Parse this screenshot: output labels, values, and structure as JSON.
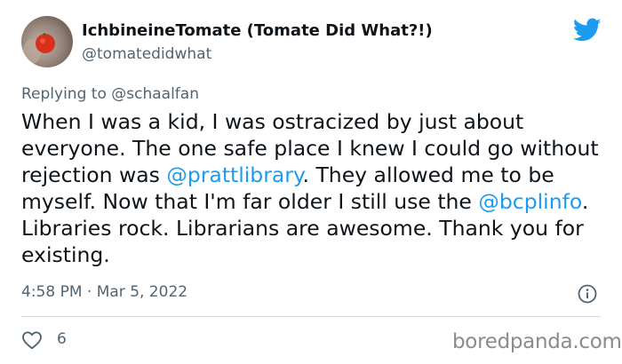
{
  "author": {
    "display_name": "IchbineineTomate (Tomate Did What?!)",
    "handle": "@tomatedidwhat"
  },
  "reply": {
    "prefix": "Replying to ",
    "mention": "@schaalfan"
  },
  "tweet": {
    "segments": [
      {
        "text": "When I was a kid, I was ostracized by just about everyone. The one safe place I knew I could go without rejection was ",
        "type": "text"
      },
      {
        "text": "@prattlibrary",
        "type": "mention"
      },
      {
        "text": ". They allowed me to be myself. Now that I'm far older I still use the ",
        "type": "text"
      },
      {
        "text": "@bcplinfo",
        "type": "mention"
      },
      {
        "text": ". Libraries rock. Librarians are awesome. Thank you for existing.",
        "type": "text"
      }
    ]
  },
  "meta": {
    "timestamp": "4:58 PM · Mar 5, 2022"
  },
  "engagement": {
    "likes": "6"
  },
  "watermark": "boredpanda.com",
  "icons": {
    "brand": "twitter-bird-icon",
    "info": "info-icon",
    "like": "heart-icon"
  },
  "colors": {
    "mention": "#1d9bf0",
    "secondary_text": "#536471",
    "twitter_blue": "#1d9bf0",
    "avatar_tomato": "#d9301c"
  }
}
